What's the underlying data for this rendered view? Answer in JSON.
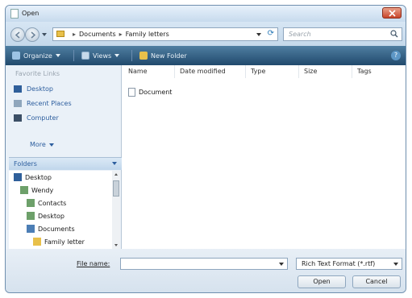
{
  "window": {
    "title": "Open"
  },
  "address": {
    "breadcrumb": [
      "Documents",
      "Family letters"
    ],
    "search_placeholder": "Search"
  },
  "toolbar": {
    "organize": "Organize",
    "views": "Views",
    "new_folder": "New Folder"
  },
  "favorites": {
    "title": "Favorite Links",
    "items": [
      "Desktop",
      "Recent Places",
      "Computer"
    ],
    "more": "More"
  },
  "folders": {
    "label": "Folders",
    "tree": [
      "Desktop",
      "Wendy",
      "Contacts",
      "Desktop",
      "Documents",
      "Family letter"
    ]
  },
  "columns": [
    "Name",
    "Date modified",
    "Type",
    "Size",
    "Tags"
  ],
  "files": [
    {
      "name": "Document"
    }
  ],
  "bottom": {
    "file_name_label": "File name:",
    "file_name_value": "",
    "file_type": "Rich Text Format (*.rtf)",
    "open_label": "Open",
    "cancel_label": "Cancel"
  },
  "colors": {
    "toolbar": "#2d5a80",
    "link": "#2d5e9e",
    "folder": "#e8c04a"
  },
  "icons": [
    "close-icon",
    "back-icon",
    "forward-icon",
    "folder-icon",
    "refresh-icon",
    "search-icon",
    "organize-icon",
    "views-icon",
    "new-folder-icon",
    "help-icon",
    "desktop-icon",
    "recent-places-icon",
    "computer-icon",
    "document-icon"
  ]
}
